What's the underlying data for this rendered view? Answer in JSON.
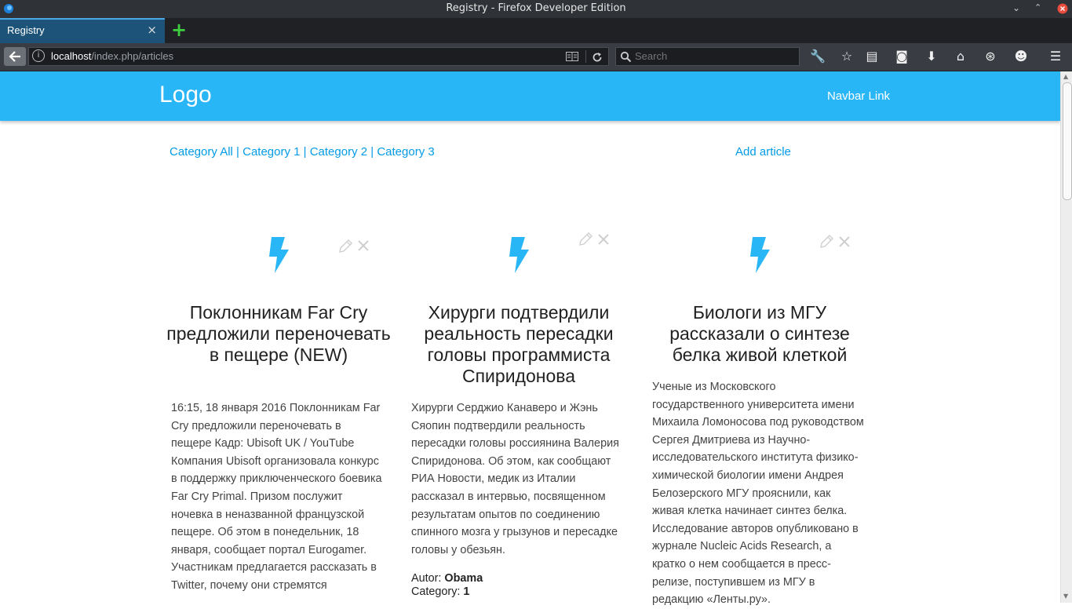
{
  "window": {
    "title": "Registry - Firefox Developer Edition"
  },
  "tab": {
    "label": "Registry",
    "close": "×",
    "new": "+"
  },
  "navbar": {
    "url_host": "localhost",
    "url_path": "/index.php/articles",
    "search_placeholder": "Search"
  },
  "page": {
    "logo": "Logo",
    "navbar_link": "Navbar Link",
    "categories": [
      "Category All",
      "Category 1",
      "Category 2",
      "Category 3"
    ],
    "separator": " | ",
    "add_article": "Add article"
  },
  "colors": {
    "accent": "#29b6f6",
    "link": "#039be5"
  },
  "articles": [
    {
      "title": "Поклонникам Far Cry предложили переночевать в пещере (NEW)",
      "body": "16:15, 18 января 2016 Поклонникам Far Cry предложили переночевать в пещере Кадр: Ubisoft UK / YouTube Компания Ubisoft организовала конкурс в поддержку приключенческого боевика Far Cry Primal. Призом послужит ночевка в неназванной французской пещере. Об этом в понедельник, 18 января, сообщает портал Eurogamer. Участникам предлагается рассказать в Twitter, почему они стремятся"
    },
    {
      "title": "Хирурги подтвердили реальность пересадки головы программиста Спиридонова",
      "body": "Хирурги Серджио Канаверо и Жэнь Сяопин подтвердили реальность пересадки головы россиянина Валерия Спиридонова. Об этом, как сообщают РИА Новости, медик из Италии рассказал в интервью, посвященном результатам опытов по соединению спинного мозга у грызунов и пересадке головы у обезьян.",
      "author_label": "Autor: ",
      "author": "Obama",
      "category_label": "Category: ",
      "category": "1"
    },
    {
      "title": "Биологи из МГУ рассказали о синтезе белка живой клеткой",
      "body": "Ученые из Московского государственного университета имени Михаила Ломоносова под руководством Сергея Дмитриева из Научно-исследовательского института физико-химической биологии имени Андрея Белозерского МГУ прояснили, как живая клетка начинает синтез белка. Исследование авторов опубликовано в журнале Nucleic Acids Research, а кратко о нем сообщается в пресс-релизе, поступившем из МГУ в редакцию «Ленты.ру»."
    }
  ]
}
